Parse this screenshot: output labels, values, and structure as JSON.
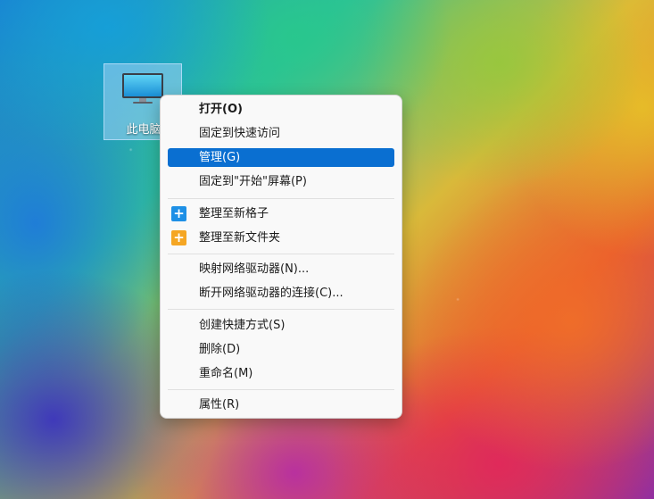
{
  "desktop": {
    "icon": {
      "label": "此电脑",
      "icon_name": "monitor-icon"
    }
  },
  "context_menu": {
    "items": [
      {
        "label": "打开(O)",
        "bold": true
      },
      {
        "label": "固定到快速访问"
      },
      {
        "label": "管理(G)",
        "highlighted": true
      },
      {
        "label": "固定到\"开始\"屏幕(P)"
      },
      {
        "label": "整理至新格子",
        "icon": "plus-icon",
        "icon_glyph": "+",
        "icon_color": "#1e90e6"
      },
      {
        "label": "整理至新文件夹",
        "icon": "plus-icon",
        "icon_glyph": "+",
        "icon_color": "#f5a623"
      },
      {
        "label": "映射网络驱动器(N)..."
      },
      {
        "label": "断开网络驱动器的连接(C)..."
      },
      {
        "label": "创建快捷方式(S)"
      },
      {
        "label": "删除(D)"
      },
      {
        "label": "重命名(M)"
      },
      {
        "label": "属性(R)"
      }
    ]
  },
  "colors": {
    "highlight": "#0a6fd1",
    "menu_background": "#f9f9f9"
  }
}
